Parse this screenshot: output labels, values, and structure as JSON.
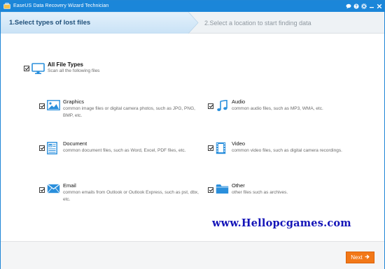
{
  "window": {
    "title": "EaseUS Data Recovery Wizard Technician"
  },
  "steps": {
    "step1_label": "1.Select types of lost files",
    "step2_label": "2.Select a location to start finding data"
  },
  "all_types": {
    "name": "All File Types",
    "description": "Scan all the following files",
    "checked": true
  },
  "categories": [
    {
      "name": "Graphics",
      "description": "common image files or digital camera photos, such as JPG, PNG, BMP, etc.",
      "icon": "image-icon",
      "checked": true
    },
    {
      "name": "Audio",
      "description": "common audio files, such as MP3, WMA, etc.",
      "icon": "music-note-icon",
      "checked": true
    },
    {
      "name": "Document",
      "description": "common document files, such as Word, Excel, PDF files, etc.",
      "icon": "document-icon",
      "checked": true
    },
    {
      "name": "Video",
      "description": "common video files, such as digital camera recordings.",
      "icon": "film-icon",
      "checked": true
    },
    {
      "name": "Email",
      "description": "common emails from Outlook or Outlook Express, such as pst, dbx, etc.",
      "icon": "envelope-icon",
      "checked": true
    },
    {
      "name": "Other",
      "description": "other files such as archives.",
      "icon": "folder-icon",
      "checked": true
    }
  ],
  "watermark": "www.Hellopcgames.com",
  "footer": {
    "next_label": "Next"
  },
  "colors": {
    "titlebar": "#1b86d9",
    "accent_icon": "#2a8fdc",
    "next_button": "#f27818",
    "watermark": "#1414b8"
  }
}
